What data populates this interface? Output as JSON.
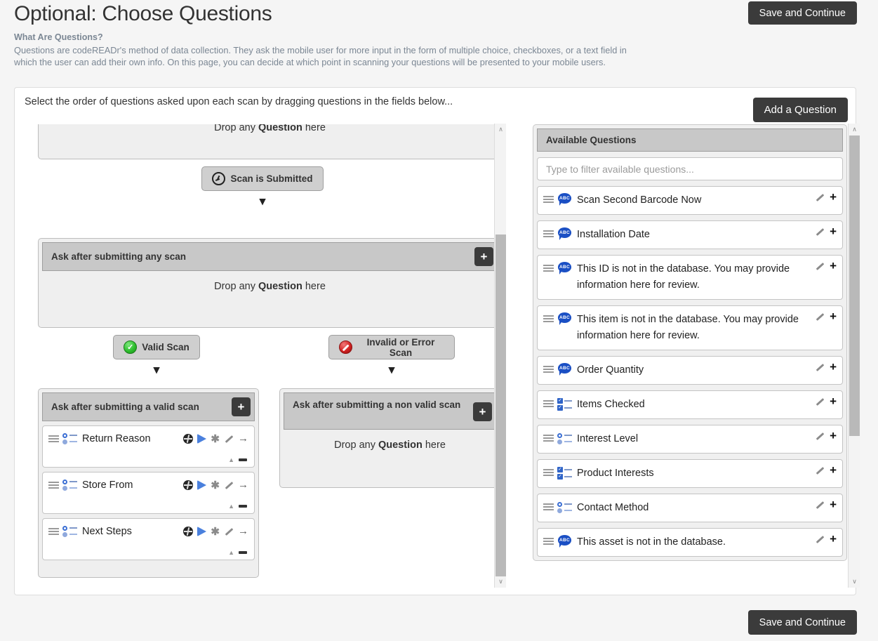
{
  "header": {
    "title": "Optional: Choose Questions",
    "subhead": "What Are Questions?",
    "subtext": "Questions are codeREADr's method of data collection. They ask the mobile user for more input in the form of multiple choice, checkboxes, or a text field in which the user can add their own info. On this page, you can decide at which point in scanning your questions will be presented to your mobile users.",
    "save_label": "Save and Continue"
  },
  "footer": {
    "save_label": "Save and Continue"
  },
  "panel": {
    "instruction": "Select the order of questions asked upon each scan by dragging questions in the fields below...",
    "add_question_label": "Add a Question"
  },
  "flow": {
    "drop_prefix": "Drop any ",
    "drop_strong": "Question",
    "drop_suffix": " here",
    "scan_submitted_label": "Scan is Submitted",
    "valid_scan_label": "Valid Scan",
    "invalid_scan_label": "Invalid or Error Scan",
    "any_scan_zone_title": "Ask after submitting any scan",
    "valid_zone_title": "Ask after submitting a valid scan",
    "invalid_zone_title": "Ask after submitting a non valid scan",
    "plus_label": "+",
    "chevron": "⌵",
    "valid_questions": [
      {
        "name": "Return Reason",
        "type": "radio-list"
      },
      {
        "name": "Store From",
        "type": "radio-list"
      },
      {
        "name": "Next Steps",
        "type": "radio-list"
      }
    ]
  },
  "available": {
    "header": "Available Questions",
    "filter_placeholder": "Type to filter available questions...",
    "filter_value": "",
    "items": [
      {
        "label": "Scan Second Barcode Now",
        "type": "barcode-bubble",
        "glyph": "ABC"
      },
      {
        "label": "Installation Date",
        "type": "bubble",
        "glyph": "ABC"
      },
      {
        "label": "This ID is not in the database. You may provide information here for review.",
        "type": "bubble",
        "glyph": "ABC"
      },
      {
        "label": "This item is not in the database. You may provide information here for review.",
        "type": "bubble",
        "glyph": "ABC"
      },
      {
        "label": "Order Quantity",
        "type": "bubble",
        "glyph": "ABC"
      },
      {
        "label": "Items Checked",
        "type": "checkbox-list"
      },
      {
        "label": "Interest Level",
        "type": "radio-list"
      },
      {
        "label": "Product Interests",
        "type": "checkbox-list"
      },
      {
        "label": "Contact Method",
        "type": "radio-list"
      },
      {
        "label": "This asset is not in the database.",
        "type": "bubble",
        "glyph": "ABC"
      }
    ]
  },
  "icons": {
    "edit": "pencil-icon",
    "add": "+",
    "globe": "globe-icon",
    "tag": "tag-icon",
    "required": "✱",
    "goto": "→",
    "collapse": "▲",
    "remove": "—",
    "scroll_up": "∧",
    "scroll_down": "∨"
  },
  "colors": {
    "accent_dark": "#3b3b3b",
    "header_gray": "#c8c8c8",
    "blue": "#1a4fc4",
    "valid_green": "#2fbf2f",
    "error_red": "#d32222"
  }
}
